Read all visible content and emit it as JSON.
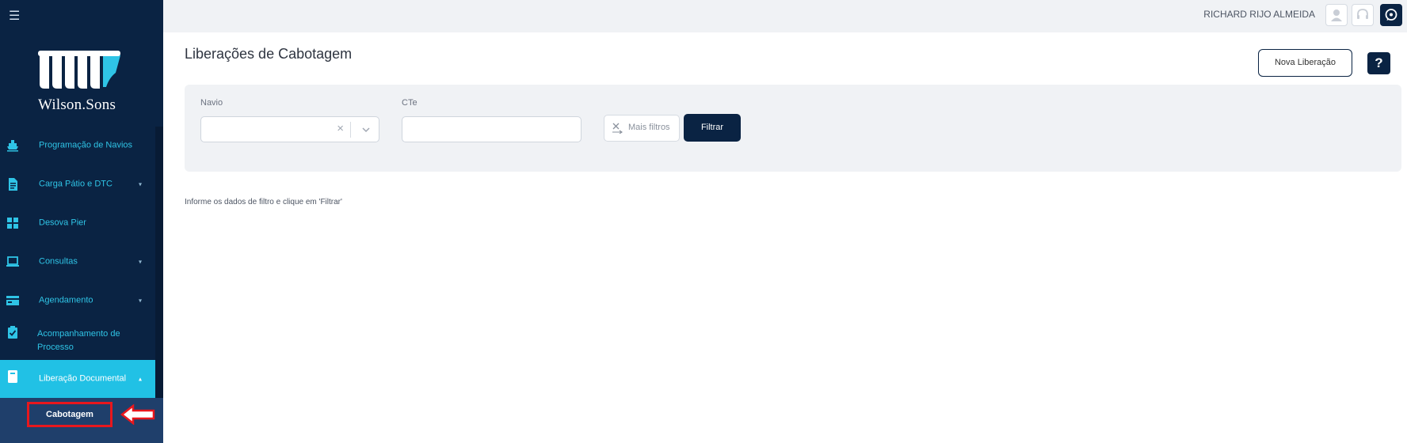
{
  "brand": {
    "name": "Wilson.Sons"
  },
  "header": {
    "user_name": "RICHARD RIJO ALMEIDA"
  },
  "sidebar": {
    "items": [
      {
        "label": "Programação de Navios",
        "icon": "ship-icon",
        "has_children": false
      },
      {
        "label": "Carga Pátio e DTC",
        "icon": "document-icon",
        "has_children": true
      },
      {
        "label": "Desova Pier",
        "icon": "boxes-icon",
        "has_children": false
      },
      {
        "label": "Consultas",
        "icon": "laptop-icon",
        "has_children": true
      },
      {
        "label": "Agendamento",
        "icon": "calendar-card-icon",
        "has_children": true
      },
      {
        "label": "Acompanhamento de Processo",
        "icon": "clipboard-check-icon",
        "has_children": false
      },
      {
        "label": "Liberação Documental",
        "icon": "book-icon",
        "has_children": true,
        "active": true
      }
    ],
    "sub_items": [
      {
        "label": "Cabotagem",
        "selected": true
      }
    ]
  },
  "page": {
    "title": "Liberações de Cabotagem",
    "new_button": "Nova Liberação",
    "help_button": "?",
    "hint": "Informe os dados de filtro e clique em 'Filtrar'"
  },
  "filters": {
    "navio": {
      "label": "Navio",
      "value": ""
    },
    "cte": {
      "label": "CTe",
      "value": ""
    },
    "more_filters": "Mais filtros",
    "filter_button": "Filtrar"
  },
  "colors": {
    "sidebar_bg": "#0a2343",
    "accent": "#21c1e5",
    "highlight": "#e8171d"
  }
}
